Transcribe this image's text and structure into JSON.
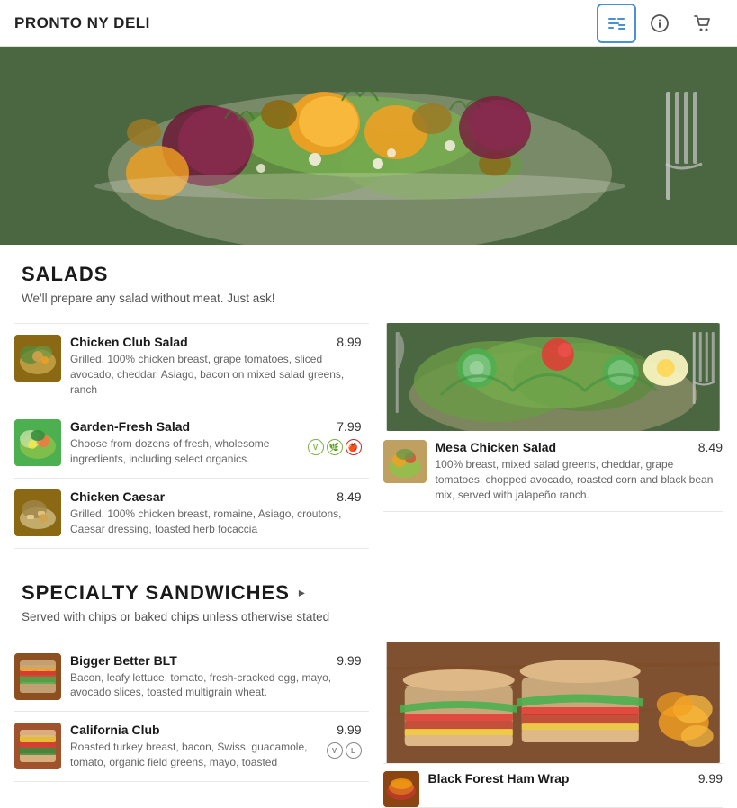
{
  "app": {
    "title": "PRONTO NY DELI",
    "icons": {
      "menu_icon": "☰",
      "info_icon": "ⓘ",
      "cart_icon": "🛒"
    }
  },
  "sections": {
    "salads": {
      "title": "SALADS",
      "subtitle": "We'll prepare any salad without meat. Just ask!",
      "items": [
        {
          "name": "Chicken Club Salad",
          "price": "8.99",
          "description": "Grilled, 100% chicken breast, grape tomatoes, sliced avocado, cheddar, Asiago, bacon on mixed salad greens, ranch",
          "badges": [],
          "thumb_class": "thumb-chicken-club"
        },
        {
          "name": "Garden-Fresh Salad",
          "price": "7.99",
          "description": "Choose from dozens of fresh, wholesome ingredients, including select organics.",
          "badges": [
            "V",
            "L",
            "O"
          ],
          "thumb_class": "thumb-garden-fresh"
        },
        {
          "name": "Chicken Caesar",
          "price": "8.49",
          "description": "Grilled, 100% chicken breast, romaine, Asiago, croutons, Caesar dressing, toasted herb focaccia",
          "badges": [],
          "thumb_class": "thumb-chicken-caesar"
        }
      ],
      "featured": {
        "name": "Mesa Chicken Salad",
        "price": "8.49",
        "description": "100% breast, mixed salad greens, cheddar, grape tomatoes, chopped avocado, roasted corn and black bean mix, served with jalapeño ranch.",
        "thumb_class": "thumb-mesa-chicken"
      }
    },
    "specialty_sandwiches": {
      "title": "SPECIALTY SANDWICHES",
      "subtitle": "Served with chips or baked chips unless otherwise stated",
      "items": [
        {
          "name": "Bigger Better BLT",
          "price": "9.99",
          "description": "Bacon, leafy lettuce, tomato, fresh-cracked egg, mayo, avocado slices, toasted multigrain wheat.",
          "badges": [],
          "thumb_class": "thumb-blt"
        },
        {
          "name": "California Club",
          "price": "9.99",
          "description": "Roasted turkey breast, bacon, Swiss, guacamole, tomato, organic field greens, mayo, toasted",
          "badges": [
            "V",
            "L"
          ],
          "thumb_class": "thumb-california-club"
        }
      ],
      "featured": {
        "name": "Black Forest Ham Wrap",
        "price": "9.99",
        "description": ""
      }
    }
  }
}
